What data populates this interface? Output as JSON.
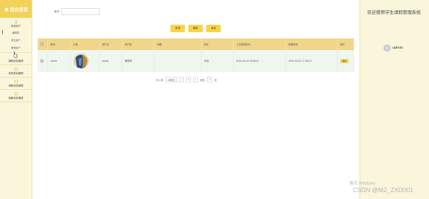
{
  "sidebar": {
    "title": "后台首页",
    "groups": [
      {
        "title": "系统用户",
        "items": [
          "管理员",
          "学生用户",
          "教师用户"
        ]
      },
      {
        "title": "课程信息管理",
        "items": []
      },
      {
        "title": "考勤签到管理",
        "items": []
      },
      {
        "title": "请假信息管理",
        "items": []
      },
      {
        "title": "销假信息管理",
        "items": []
      }
    ]
  },
  "search": {
    "label": "账号",
    "value": "",
    "placeholder": ""
  },
  "toolbar": {
    "query": "查询",
    "delete": "删除",
    "add": "添加"
  },
  "table": {
    "headers": [
      "",
      "账号",
      "头像",
      "用户名",
      "用户类",
      "邮箱",
      "状态",
      "上次登录时间",
      "新增时间",
      "操作"
    ],
    "rows": [
      {
        "account": "admin",
        "username": "admin",
        "role": "管理员",
        "email": "",
        "status": "可用",
        "last_login": "2024-03-04 08:58:11",
        "created": "2024-03-31 17:35:13",
        "action": "详情"
      }
    ]
  },
  "pagination": {
    "total": "共 1 条",
    "per_page": "10条/页",
    "prev": "‹",
    "page": "1",
    "next": "›",
    "goto_label": "前往",
    "goto_value": "1",
    "page_suffix": "页"
  },
  "right_panel": {
    "welcome": "欢迎使用学生请假管理系统",
    "user": "admin"
  },
  "watermark": {
    "line1": "激活 Windows",
    "line2": "CSDN @MZ_ZXD001"
  },
  "colors": {
    "accent": "#f3d25a",
    "header_row": "#efd68a",
    "data_row": "#eef6ee",
    "sidebar_bg": "#faf6dc"
  }
}
